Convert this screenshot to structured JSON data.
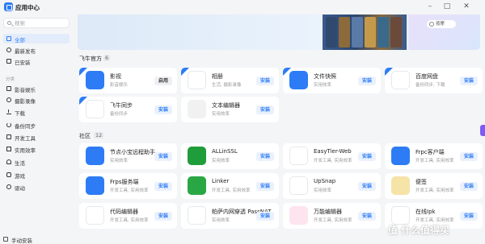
{
  "window": {
    "title": "应用中心"
  },
  "search": {
    "placeholder": "搜索"
  },
  "sidebar": {
    "top_items": [
      {
        "label": "全部",
        "icon": "grid-icon",
        "active": true
      },
      {
        "label": "最新发布",
        "icon": "star-icon"
      },
      {
        "label": "已安装",
        "icon": "installed-icon"
      }
    ],
    "category_heading": "分类",
    "categories": [
      {
        "label": "影音娱乐",
        "icon": "film-icon"
      },
      {
        "label": "摄影录像",
        "icon": "camera-icon"
      },
      {
        "label": "下载",
        "icon": "download-icon"
      },
      {
        "label": "备份同步",
        "icon": "sync-icon"
      },
      {
        "label": "开发工具",
        "icon": "code-icon"
      },
      {
        "label": "实用效率",
        "icon": "toolbox-icon"
      },
      {
        "label": "生活",
        "icon": "life-icon"
      },
      {
        "label": "游戏",
        "icon": "gamepad-icon"
      },
      {
        "label": "驱动",
        "icon": "driver-icon"
      }
    ],
    "manual_install": "手动安装"
  },
  "banner": {
    "search_pill": "按摩"
  },
  "official": {
    "title": "飞牛官方",
    "count": "6",
    "apps": [
      {
        "name": "影视",
        "desc": "影音娱乐",
        "button": "启用",
        "button_state": "open",
        "corner": true,
        "icon": "video-play-icon",
        "color": "#2d7cf6"
      },
      {
        "name": "相册",
        "desc": "生活, 摄影录像",
        "button": "安装",
        "corner": true,
        "icon": "photos-flower-icon",
        "color": "#ffffff"
      },
      {
        "name": "文件快照",
        "desc": "实用效率",
        "button": "安装",
        "corner": true,
        "icon": "file-snapshot-icon",
        "color": "#2d7cf6"
      },
      {
        "name": "百度网盘",
        "desc": "备份同步, 下载",
        "button": "安装",
        "corner": true,
        "icon": "baidu-cloud-icon",
        "color": "#ffffff"
      },
      {
        "name": "飞牛同步",
        "desc": "备份同步",
        "button": "安装",
        "corner": true,
        "icon": "fn-sync-icon",
        "color": "#ffffff"
      },
      {
        "name": "文本编辑器",
        "desc": "实用效率",
        "button": "安装",
        "corner": false,
        "icon": "text-editor-icon",
        "color": "#f1f1f1"
      }
    ]
  },
  "community": {
    "title": "社区",
    "count": "12",
    "apps": [
      {
        "name": "节点小宝远程助手",
        "desc": "实用效率",
        "button": "安装",
        "icon": "node-helper-icon",
        "color": "#2d7cf6"
      },
      {
        "name": "ALLinSSL",
        "desc": "实用效率",
        "button": "安装",
        "icon": "allinssl-icon",
        "color": "#1f9d3a"
      },
      {
        "name": "EasyTier-Web",
        "desc": "开发工具, 实用效率",
        "button": "安装",
        "icon": "easytier-icon",
        "color": "#ffffff"
      },
      {
        "name": "Frpc客户端",
        "desc": "开发工具, 实用效率",
        "button": "安装",
        "icon": "frpc-icon",
        "color": "#2d7cf6"
      },
      {
        "name": "Frps服务端",
        "desc": "开发工具, 实用效率",
        "button": "安装",
        "icon": "frps-icon",
        "color": "#2d7cf6"
      },
      {
        "name": "Linker",
        "desc": "开发工具, 实用效率",
        "button": "安装",
        "icon": "linker-icon",
        "color": "#2aa745"
      },
      {
        "name": "UpSnap",
        "desc": "实用效率",
        "button": "安装",
        "icon": "upsnap-icon",
        "color": "#ffffff"
      },
      {
        "name": "便签",
        "desc": "开发工具, 实用效率",
        "button": "安装",
        "icon": "notes-icon",
        "color": "#f6e3a8"
      },
      {
        "name": "代码编辑器",
        "desc": "开发工具, 实用效率",
        "button": "安装",
        "icon": "code-editor-icon",
        "color": "#ffffff"
      },
      {
        "name": "帕萨内网穿透 PassNAT",
        "desc": "实用效率",
        "button": "安装",
        "icon": "passnat-icon",
        "color": "#ffffff"
      },
      {
        "name": "万能编辑器",
        "desc": "开发工具, 实用效率",
        "button": "安装",
        "icon": "universal-editor-icon",
        "color": "#fde4ee"
      },
      {
        "name": "在线Ipk",
        "desc": "开发工具, 实用效率",
        "button": "安装",
        "icon": "ipk-icon",
        "color": "#ffffff"
      }
    ]
  },
  "watermark": "值 什么值得买",
  "colors": {
    "accent": "#2d7cf6",
    "background": "#f4f5f7"
  }
}
